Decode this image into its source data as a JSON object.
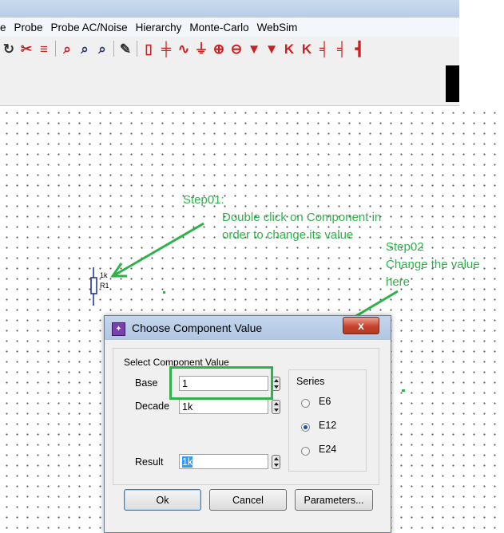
{
  "menu": [
    "e",
    "Probe",
    "Probe AC/Noise",
    "Hierarchy",
    "Monte-Carlo",
    "WebSim"
  ],
  "toolbar_icons": [
    {
      "name": "redo-icon",
      "glyph": "↻",
      "color": "dark"
    },
    {
      "name": "delete-wire-icon",
      "glyph": "✂",
      "color": "red"
    },
    {
      "name": "wire-icon",
      "glyph": "≡",
      "color": "red"
    },
    {
      "sep": true
    },
    {
      "name": "zoom-fit-icon",
      "glyph": "⌕",
      "color": "red"
    },
    {
      "name": "zoom-out-icon",
      "glyph": "⌕",
      "color": "blue"
    },
    {
      "name": "zoom-in-icon",
      "glyph": "⌕",
      "color": "blue"
    },
    {
      "sep": true
    },
    {
      "name": "pencil-icon",
      "glyph": "✎",
      "color": "dark"
    },
    {
      "sep": true
    },
    {
      "name": "resistor-icon",
      "glyph": "▯",
      "color": "red"
    },
    {
      "name": "capacitor-icon",
      "glyph": "╪",
      "color": "red"
    },
    {
      "name": "inductor-icon",
      "glyph": "∿",
      "color": "red"
    },
    {
      "name": "ground-icon",
      "glyph": "⏚",
      "color": "red"
    },
    {
      "name": "current-source-icon",
      "glyph": "⊕",
      "color": "red"
    },
    {
      "name": "voltage-source-icon",
      "glyph": "⊖",
      "color": "red"
    },
    {
      "name": "diode-icon",
      "glyph": "▼",
      "color": "red"
    },
    {
      "name": "zener-icon",
      "glyph": "▼",
      "color": "red"
    },
    {
      "name": "npn-icon",
      "glyph": "K",
      "color": "red"
    },
    {
      "name": "pnp-icon",
      "glyph": "K",
      "color": "red"
    },
    {
      "name": "nmos-icon",
      "glyph": "╡",
      "color": "red"
    },
    {
      "name": "pmos-icon",
      "glyph": "╡",
      "color": "red"
    },
    {
      "name": "jfet-icon",
      "glyph": "┫",
      "color": "red"
    }
  ],
  "annotations": {
    "step01_title": "Step01:",
    "step01_line1": "Double click on Component in",
    "step01_line2": "order to change its value",
    "step02_title": "Step02",
    "step02_line1": "Change the value",
    "step02_line2": "here"
  },
  "component": {
    "value": "1k",
    "ref": "R1"
  },
  "dialog": {
    "title": "Choose Component Value",
    "close": "x",
    "group_label": "Select Component Value",
    "base_label": "Base",
    "base_value": "1",
    "decade_label": "Decade",
    "decade_value": "1k",
    "result_label": "Result",
    "result_value": "1k",
    "series_label": "Series",
    "series_options": [
      "E6",
      "E12",
      "E24"
    ],
    "series_selected": "E12",
    "ok": "Ok",
    "cancel": "Cancel",
    "parameters": "Parameters..."
  },
  "colors": {
    "annotation": "#2fb24a",
    "highlight": "#3399ff"
  }
}
